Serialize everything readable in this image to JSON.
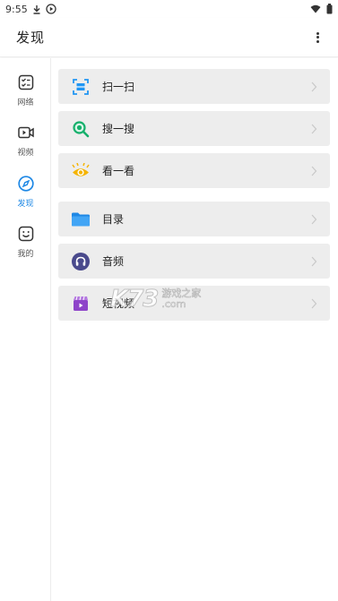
{
  "status_bar": {
    "time": "9:55",
    "download_icon": "download-icon",
    "play_icon": "play-circle-icon",
    "wifi_icon": "wifi-icon",
    "battery_icon": "battery-icon"
  },
  "app_bar": {
    "title": "发现",
    "menu_icon": "more-vert-icon"
  },
  "side_nav": {
    "active_color": "#1e88e5",
    "items": [
      {
        "label": "网络",
        "icon": "checklist-icon"
      },
      {
        "label": "视频",
        "icon": "video-icon"
      },
      {
        "label": "发现",
        "icon": "compass-icon"
      },
      {
        "label": "我的",
        "icon": "smiley-icon"
      }
    ]
  },
  "list": {
    "items": [
      {
        "label": "扫一扫",
        "icon": "scan-icon"
      },
      {
        "label": "搜一搜",
        "icon": "search-icon"
      },
      {
        "label": "看一看",
        "icon": "eye-icon"
      },
      {
        "label": "目录",
        "icon": "folder-icon"
      },
      {
        "label": "音频",
        "icon": "headphones-icon"
      },
      {
        "label": "短视频",
        "icon": "clapperboard-icon"
      }
    ]
  },
  "watermark": {
    "brand": "K73",
    "cn": "游戏之家",
    "com": ".com"
  }
}
